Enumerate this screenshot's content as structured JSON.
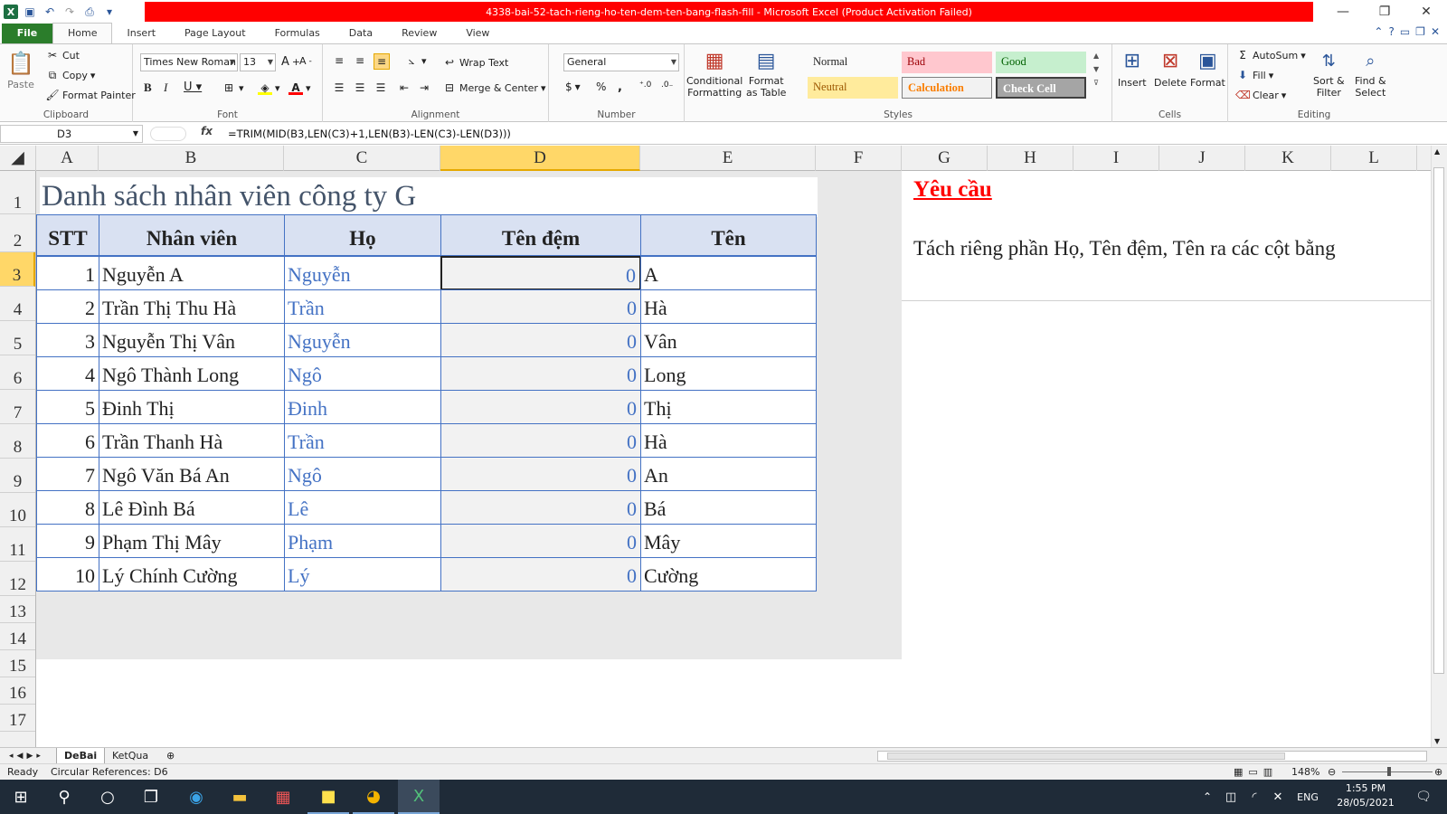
{
  "window": {
    "title": "4338-bai-52-tach-rieng-ho-ten-dem-ten-bang-flash-fill  -  Microsoft Excel (Product Activation Failed)"
  },
  "ribbon_tabs": [
    "File",
    "Home",
    "Insert",
    "Page Layout",
    "Formulas",
    "Data",
    "Review",
    "View"
  ],
  "clipboard": {
    "paste": "Paste",
    "cut": "Cut",
    "copy": "Copy",
    "format_painter": "Format Painter",
    "label": "Clipboard"
  },
  "font": {
    "name": "Times New Roman",
    "size": "13",
    "label": "Font"
  },
  "alignment": {
    "wrap": "Wrap Text",
    "merge": "Merge & Center",
    "label": "Alignment"
  },
  "number": {
    "format": "General",
    "label": "Number",
    "currency": "$",
    "percent": "%",
    "comma": ","
  },
  "styles": {
    "conditional": "Conditional",
    "conditional2": "Formatting",
    "format_table": "Format",
    "format_table2": "as Table",
    "cells": [
      {
        "label": "Normal",
        "bg": "#ffffff",
        "fg": "#000000"
      },
      {
        "label": "Bad",
        "bg": "#ffc7ce",
        "fg": "#9c0006"
      },
      {
        "label": "Good",
        "bg": "#c6efce",
        "fg": "#006100"
      },
      {
        "label": "Neutral",
        "bg": "#ffeb9c",
        "fg": "#9c5700"
      },
      {
        "label": "Calculation",
        "bg": "#f2f2f2",
        "fg": "#fa7d00"
      },
      {
        "label": "Check Cell",
        "bg": "#a5a5a5",
        "fg": "#ffffff"
      }
    ],
    "label": "Styles"
  },
  "cells_group": {
    "insert": "Insert",
    "delete": "Delete",
    "format": "Format",
    "label": "Cells"
  },
  "editing": {
    "autosum": "AutoSum",
    "fill": "Fill",
    "clear": "Clear",
    "sort": "Sort &",
    "sort2": "Filter",
    "find": "Find &",
    "find2": "Select",
    "label": "Editing"
  },
  "formula_bar": {
    "name_box": "D3",
    "formula": "=TRIM(MID(B3,LEN(C3)+1,LEN(B3)-LEN(C3)-LEN(D3)))"
  },
  "columns": [
    "A",
    "B",
    "C",
    "D",
    "E",
    "F",
    "G",
    "H",
    "I",
    "J",
    "K",
    "L"
  ],
  "rows": [
    "1",
    "2",
    "3",
    "4",
    "5",
    "6",
    "7",
    "8",
    "9",
    "10",
    "11",
    "12",
    "13",
    "14",
    "15",
    "16",
    "17"
  ],
  "sheet": {
    "title": "Danh sách nhân viên công ty G",
    "headers": [
      "STT",
      "Nhân viên",
      "Họ",
      "Tên đệm",
      "Tên"
    ],
    "data": [
      [
        "1",
        "Nguyễn A",
        "Nguyễn",
        "0",
        "A"
      ],
      [
        "2",
        "Trần Thị Thu Hà",
        "Trần",
        "0",
        "Hà"
      ],
      [
        "3",
        "Nguyễn Thị Vân",
        "Nguyễn",
        "0",
        "Vân"
      ],
      [
        "4",
        "Ngô Thành Long",
        "Ngô",
        "0",
        "Long"
      ],
      [
        "5",
        "Đinh Thị",
        "Đinh",
        "0",
        "Thị"
      ],
      [
        "6",
        "Trần Thanh Hà",
        "Trần",
        "0",
        "Hà"
      ],
      [
        "7",
        "Ngô Văn Bá An",
        "Ngô",
        "0",
        "An"
      ],
      [
        "8",
        "Lê Đình Bá",
        "Lê",
        "0",
        "Bá"
      ],
      [
        "9",
        "Phạm Thị Mây",
        "Phạm",
        "0",
        "Mây"
      ],
      [
        "10",
        "Lý Chính Cường",
        "Lý",
        "0",
        "Cường"
      ]
    ],
    "requirement_title": "Yêu cầu",
    "requirement_text": "Tách riêng phần Họ, Tên đệm, Tên ra các cột bằng"
  },
  "sheet_tabs": [
    "DeBai",
    "KetQua"
  ],
  "status": {
    "ready": "Ready",
    "circular": "Circular References: D6",
    "zoom": "148%"
  },
  "taskbar": {
    "lang": "ENG",
    "time": "1:55 PM",
    "date": "28/05/2021"
  }
}
